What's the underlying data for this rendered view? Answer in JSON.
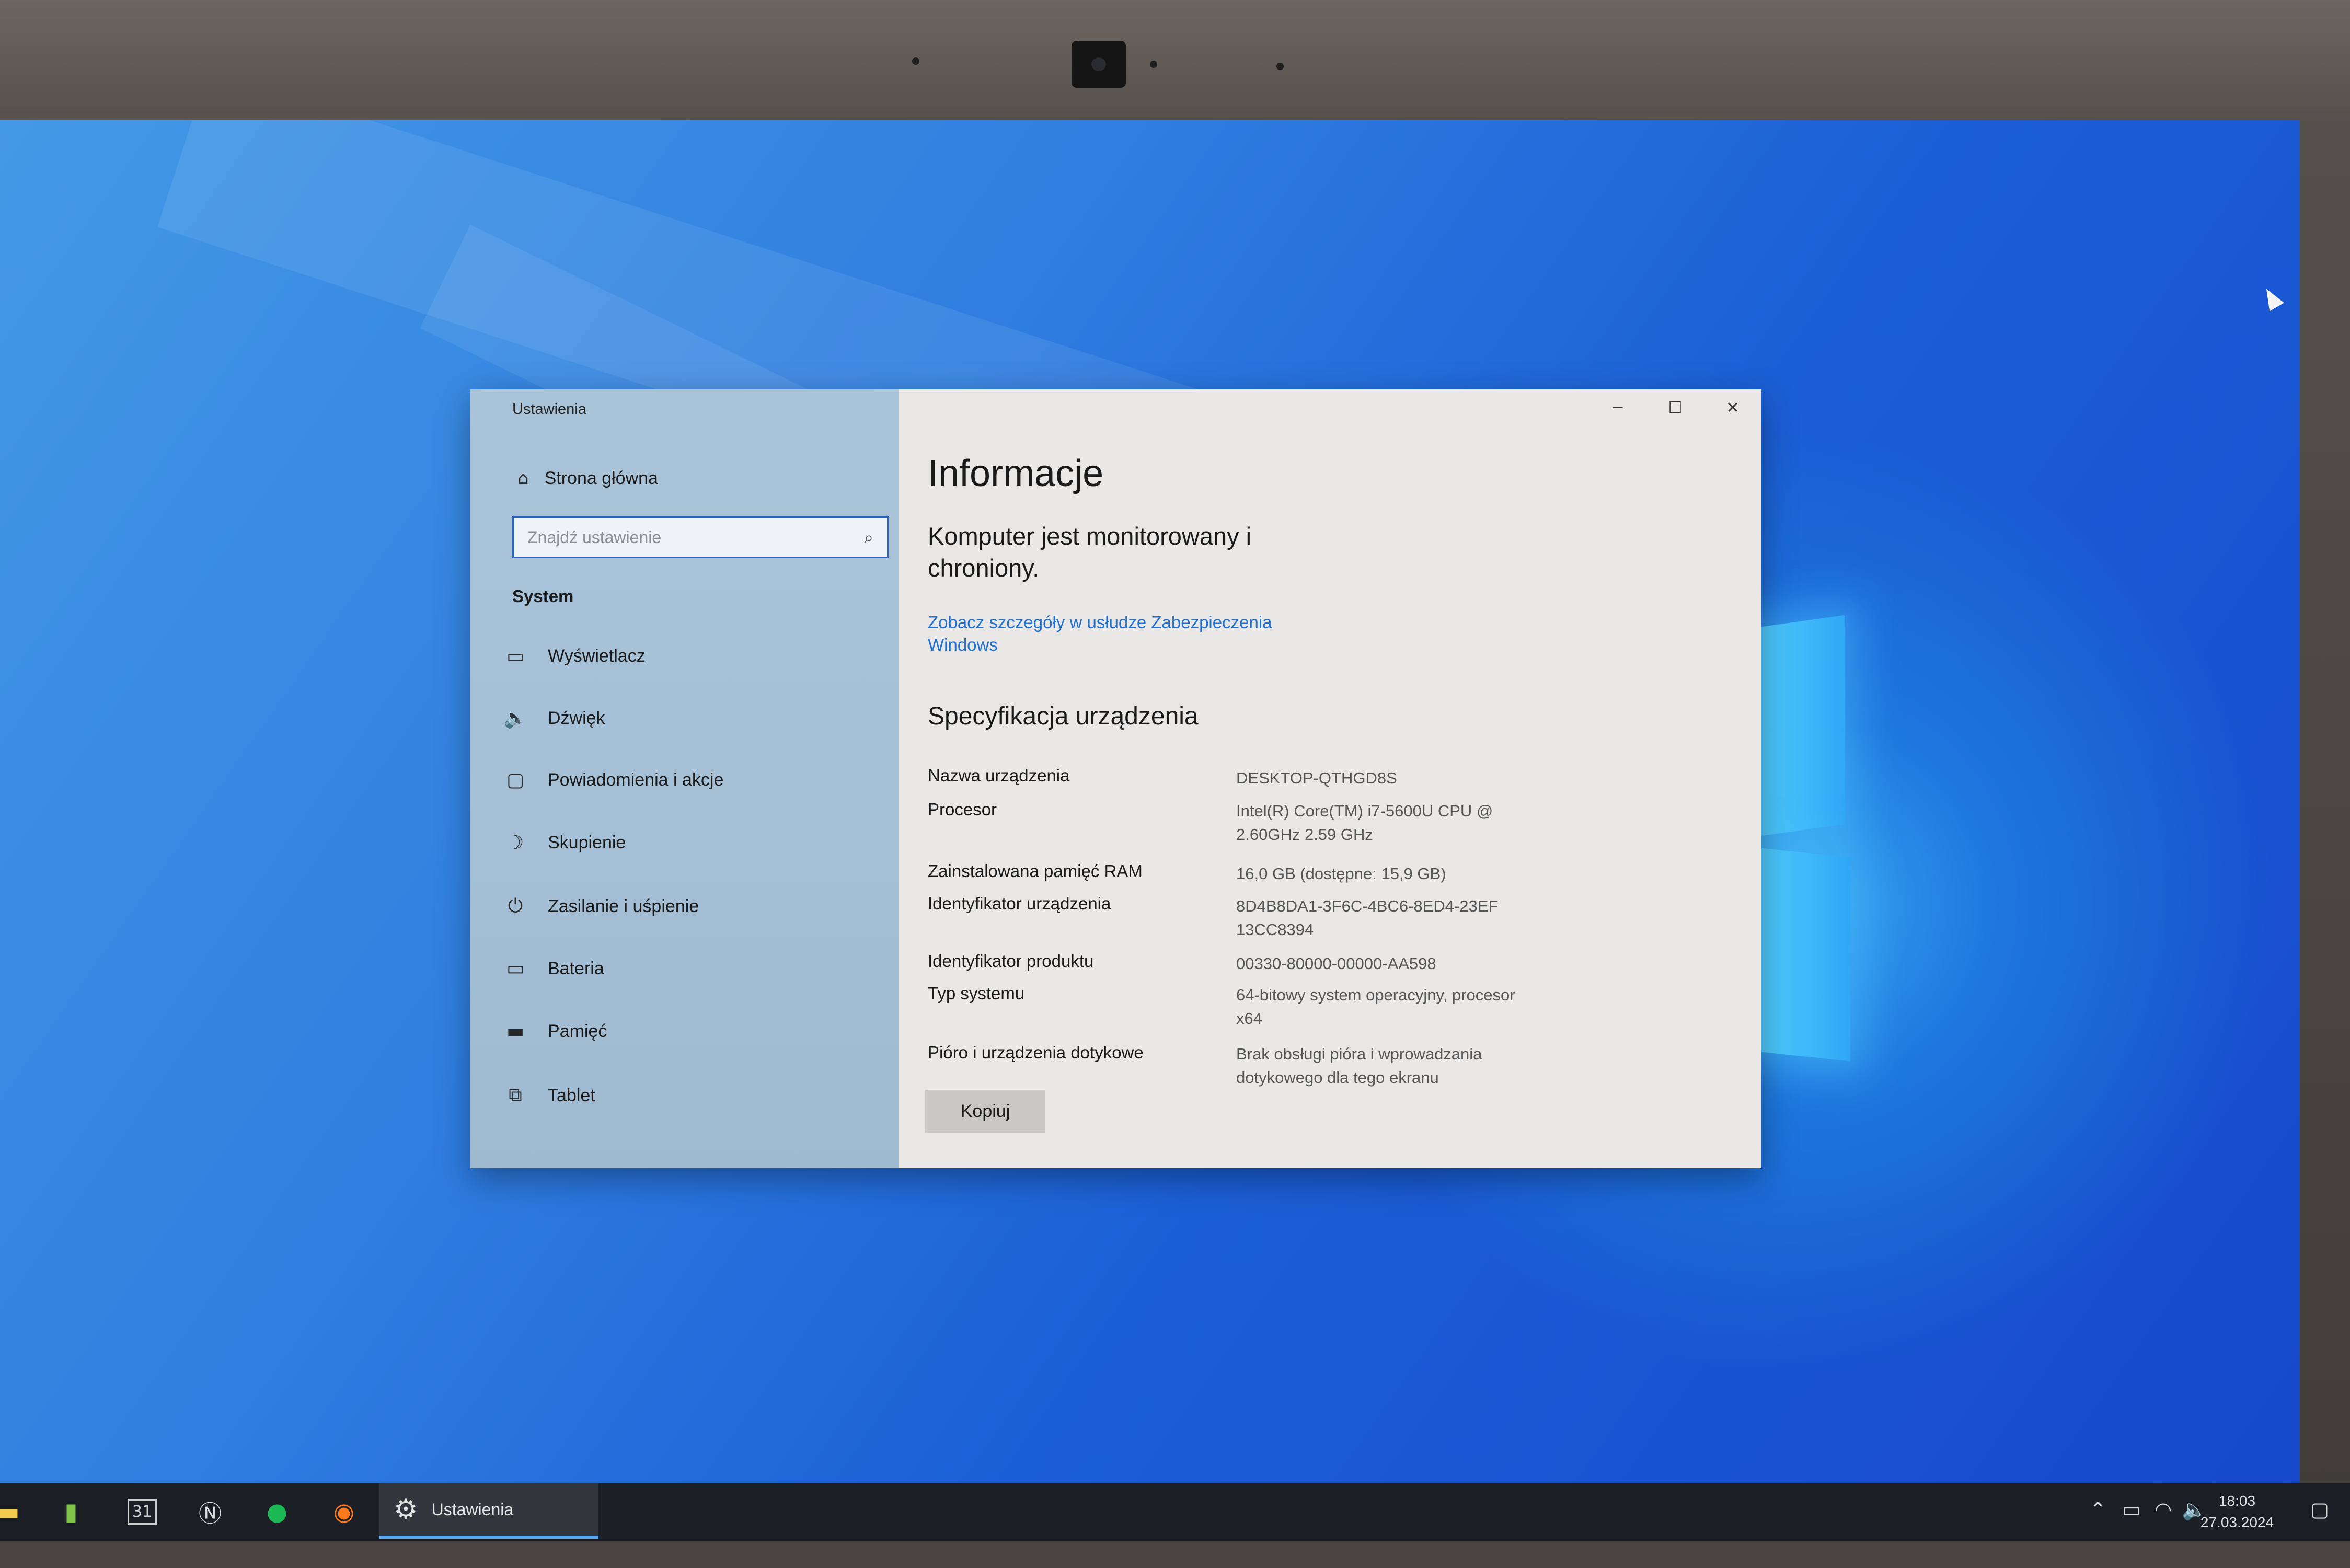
{
  "settings_window": {
    "title": "Ustawienia",
    "sidebar": {
      "home_label": "Strona główna",
      "search_placeholder": "Znajdź ustawienie",
      "section": "System",
      "items": [
        {
          "label": "Wyświetlacz",
          "icon": "monitor-icon"
        },
        {
          "label": "Dźwięk",
          "icon": "speaker-icon"
        },
        {
          "label": "Powiadomienia i akcje",
          "icon": "notification-icon"
        },
        {
          "label": "Skupienie",
          "icon": "moon-icon"
        },
        {
          "label": "Zasilanie i uśpienie",
          "icon": "power-icon"
        },
        {
          "label": "Bateria",
          "icon": "battery-icon"
        },
        {
          "label": "Pamięć",
          "icon": "storage-icon"
        },
        {
          "label": "Tablet",
          "icon": "tablet-icon"
        }
      ]
    },
    "main": {
      "heading": "Informacje",
      "protection_status": "Komputer jest monitorowany i chroniony.",
      "security_link": "Zobacz szczegóły w usłudze Zabezpieczenia Windows",
      "specs_heading": "Specyfikacja urządzenia",
      "specs": [
        {
          "label": "Nazwa urządzenia",
          "value": "DESKTOP-QTHGD8S"
        },
        {
          "label": "Procesor",
          "value": "Intel(R) Core(TM) i7-5600U CPU @ 2.60GHz   2.59 GHz"
        },
        {
          "label": "Zainstalowana pamięć RAM",
          "value": "16,0 GB (dostępne: 15,9 GB)"
        },
        {
          "label": "Identyfikator urządzenia",
          "value": "8D4B8DA1-3F6C-4BC6-8ED4-23EF 13CC8394"
        },
        {
          "label": "Identyfikator produktu",
          "value": "00330-80000-00000-AA598"
        },
        {
          "label": "Typ systemu",
          "value": "64-bitowy system operacyjny, procesor x64"
        },
        {
          "label": "Pióro i urządzenia dotykowe",
          "value": "Brak obsługi pióra i wprowadzania dotykowego dla tego ekranu"
        }
      ],
      "copy_button": "Kopiuj"
    }
  },
  "taskbar": {
    "apps": [
      "file-explorer-icon",
      "app-icon",
      "calendar-icon",
      "notion-icon",
      "spotify-icon",
      "firefox-icon"
    ],
    "calendar_day": "31",
    "active_app_label": "Ustawienia",
    "clock_time": "18:03",
    "clock_date": "27.03.2024"
  },
  "colors": {
    "accent": "#1f6fd0",
    "sidebar": "#a9c3d9",
    "desktop": "#2f7ee0"
  }
}
